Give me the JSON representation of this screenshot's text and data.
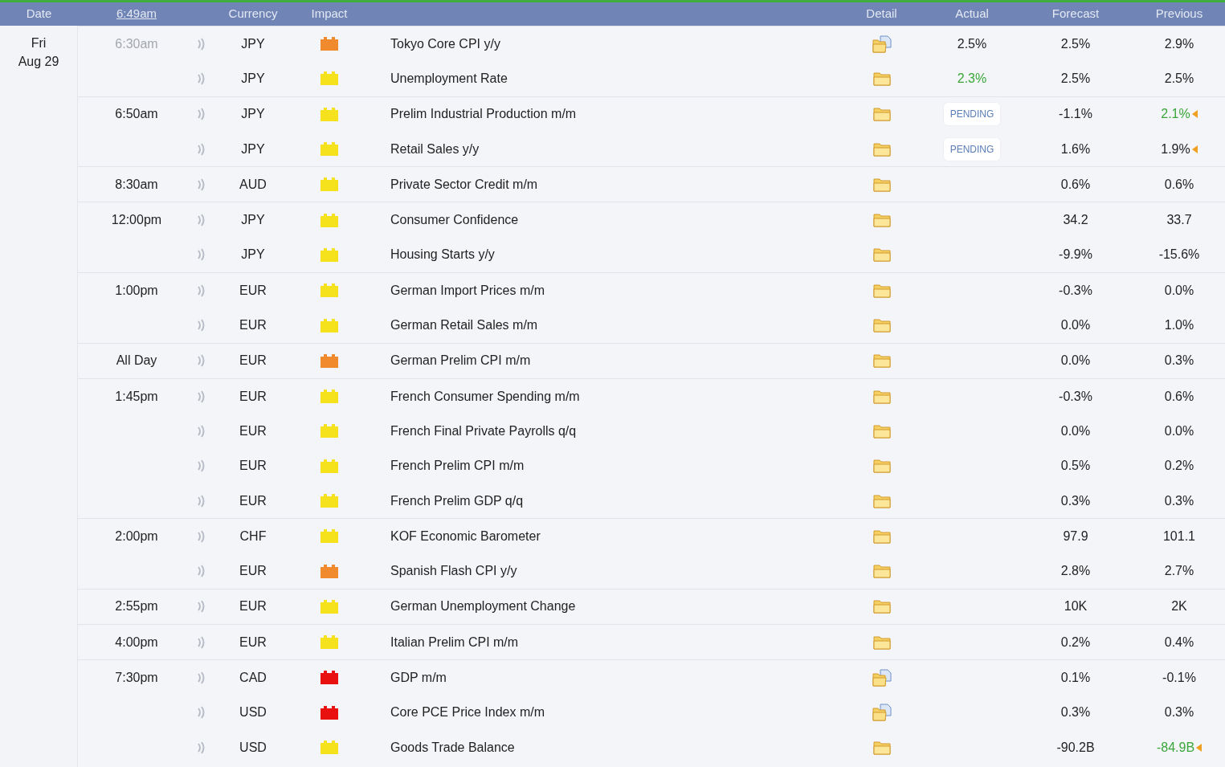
{
  "header": {
    "columns": [
      {
        "label": "Date",
        "kind": "plain"
      },
      {
        "label": "6:49am",
        "kind": "clock"
      },
      {
        "label": "Currency",
        "kind": "plain"
      },
      {
        "label": "Impact",
        "kind": "plain"
      },
      {
        "label": "Detail",
        "kind": "plain"
      },
      {
        "label": "Actual",
        "kind": "plain"
      },
      {
        "label": "Forecast",
        "kind": "plain"
      },
      {
        "label": "Previous",
        "kind": "plain"
      }
    ]
  },
  "day": {
    "weekday": "Fri",
    "date": "Aug 29"
  },
  "groups": [
    {
      "time": "6:30am",
      "dimmed": true,
      "events": [
        {
          "currency": "JPY",
          "color": "#f08a2c",
          "title": "Tokyo Core CPI y/y",
          "has_document": true,
          "actual": "2.5%",
          "actual_pending": false,
          "actual_better": false,
          "forecast": "2.5%",
          "previous": "2.9%",
          "previous_better": false,
          "revised": false
        },
        {
          "currency": "JPY",
          "color": "#f5e11c",
          "title": "Unemployment Rate",
          "has_document": false,
          "actual": "2.3%",
          "actual_pending": false,
          "actual_better": true,
          "forecast": "2.5%",
          "previous": "2.5%",
          "previous_better": false,
          "revised": false
        }
      ]
    },
    {
      "time": "6:50am",
      "dimmed": false,
      "events": [
        {
          "currency": "JPY",
          "color": "#f5e11c",
          "title": "Prelim Industrial Production m/m",
          "has_document": false,
          "actual": "PENDING",
          "actual_pending": true,
          "forecast": "-1.1%",
          "previous": "2.1%",
          "previous_better": true,
          "revised": true
        },
        {
          "currency": "JPY",
          "color": "#f5e11c",
          "title": "Retail Sales y/y",
          "has_document": false,
          "actual": "PENDING",
          "actual_pending": true,
          "forecast": "1.6%",
          "previous": "1.9%",
          "previous_better": false,
          "revised": true
        }
      ]
    },
    {
      "time": "8:30am",
      "dimmed": false,
      "events": [
        {
          "currency": "AUD",
          "color": "#f5e11c",
          "title": "Private Sector Credit m/m",
          "has_document": false,
          "forecast": "0.6%",
          "previous": "0.6%",
          "previous_better": false,
          "revised": false
        }
      ]
    },
    {
      "time": "12:00pm",
      "dimmed": false,
      "events": [
        {
          "currency": "JPY",
          "color": "#f5e11c",
          "title": "Consumer Confidence",
          "has_document": false,
          "forecast": "34.2",
          "previous": "33.7",
          "previous_better": false,
          "revised": false
        },
        {
          "currency": "JPY",
          "color": "#f5e11c",
          "title": "Housing Starts y/y",
          "has_document": false,
          "forecast": "-9.9%",
          "previous": "-15.6%",
          "previous_better": false,
          "revised": false
        }
      ]
    },
    {
      "time": "1:00pm",
      "dimmed": false,
      "events": [
        {
          "currency": "EUR",
          "color": "#f5e11c",
          "title": "German Import Prices m/m",
          "has_document": false,
          "forecast": "-0.3%",
          "previous": "0.0%",
          "previous_better": false,
          "revised": false
        },
        {
          "currency": "EUR",
          "color": "#f5e11c",
          "title": "German Retail Sales m/m",
          "has_document": false,
          "forecast": "0.0%",
          "previous": "1.0%",
          "previous_better": false,
          "revised": false
        }
      ]
    },
    {
      "time": "All Day",
      "dimmed": false,
      "events": [
        {
          "currency": "EUR",
          "color": "#f08a2c",
          "title": "German Prelim CPI m/m",
          "has_document": false,
          "forecast": "0.0%",
          "previous": "0.3%",
          "previous_better": false,
          "revised": false
        }
      ]
    },
    {
      "time": "1:45pm",
      "dimmed": false,
      "events": [
        {
          "currency": "EUR",
          "color": "#f5e11c",
          "title": "French Consumer Spending m/m",
          "has_document": false,
          "forecast": "-0.3%",
          "previous": "0.6%",
          "previous_better": false,
          "revised": false
        },
        {
          "currency": "EUR",
          "color": "#f5e11c",
          "title": "French Final Private Payrolls q/q",
          "has_document": false,
          "forecast": "0.0%",
          "previous": "0.0%",
          "previous_better": false,
          "revised": false
        },
        {
          "currency": "EUR",
          "color": "#f5e11c",
          "title": "French Prelim CPI m/m",
          "has_document": false,
          "forecast": "0.5%",
          "previous": "0.2%",
          "previous_better": false,
          "revised": false
        },
        {
          "currency": "EUR",
          "color": "#f5e11c",
          "title": "French Prelim GDP q/q",
          "has_document": false,
          "forecast": "0.3%",
          "previous": "0.3%",
          "previous_better": false,
          "revised": false
        }
      ]
    },
    {
      "time": "2:00pm",
      "dimmed": false,
      "events": [
        {
          "currency": "CHF",
          "color": "#f5e11c",
          "title": "KOF Economic Barometer",
          "has_document": false,
          "forecast": "97.9",
          "previous": "101.1",
          "previous_better": false,
          "revised": false
        },
        {
          "currency": "EUR",
          "color": "#f08a2c",
          "title": "Spanish Flash CPI y/y",
          "has_document": false,
          "forecast": "2.8%",
          "previous": "2.7%",
          "previous_better": false,
          "revised": false
        }
      ]
    },
    {
      "time": "2:55pm",
      "dimmed": false,
      "events": [
        {
          "currency": "EUR",
          "color": "#f5e11c",
          "title": "German Unemployment Change",
          "has_document": false,
          "forecast": "10K",
          "previous": "2K",
          "previous_better": false,
          "revised": false
        }
      ]
    },
    {
      "time": "4:00pm",
      "dimmed": false,
      "events": [
        {
          "currency": "EUR",
          "color": "#f5e11c",
          "title": "Italian Prelim CPI m/m",
          "has_document": false,
          "forecast": "0.2%",
          "previous": "0.4%",
          "previous_better": false,
          "revised": false
        }
      ]
    },
    {
      "time": "7:30pm",
      "dimmed": false,
      "events": [
        {
          "currency": "CAD",
          "color": "#e8110f",
          "title": "GDP m/m",
          "has_document": true,
          "forecast": "0.1%",
          "previous": "-0.1%",
          "previous_better": false,
          "revised": false
        },
        {
          "currency": "USD",
          "color": "#e8110f",
          "title": "Core PCE Price Index m/m",
          "has_document": true,
          "forecast": "0.3%",
          "previous": "0.3%",
          "previous_better": false,
          "revised": false
        },
        {
          "currency": "USD",
          "color": "#f5e11c",
          "title": "Goods Trade Balance",
          "has_document": false,
          "forecast": "-90.2B",
          "previous": "-84.9B",
          "previous_better": true,
          "revised": true
        }
      ]
    }
  ]
}
